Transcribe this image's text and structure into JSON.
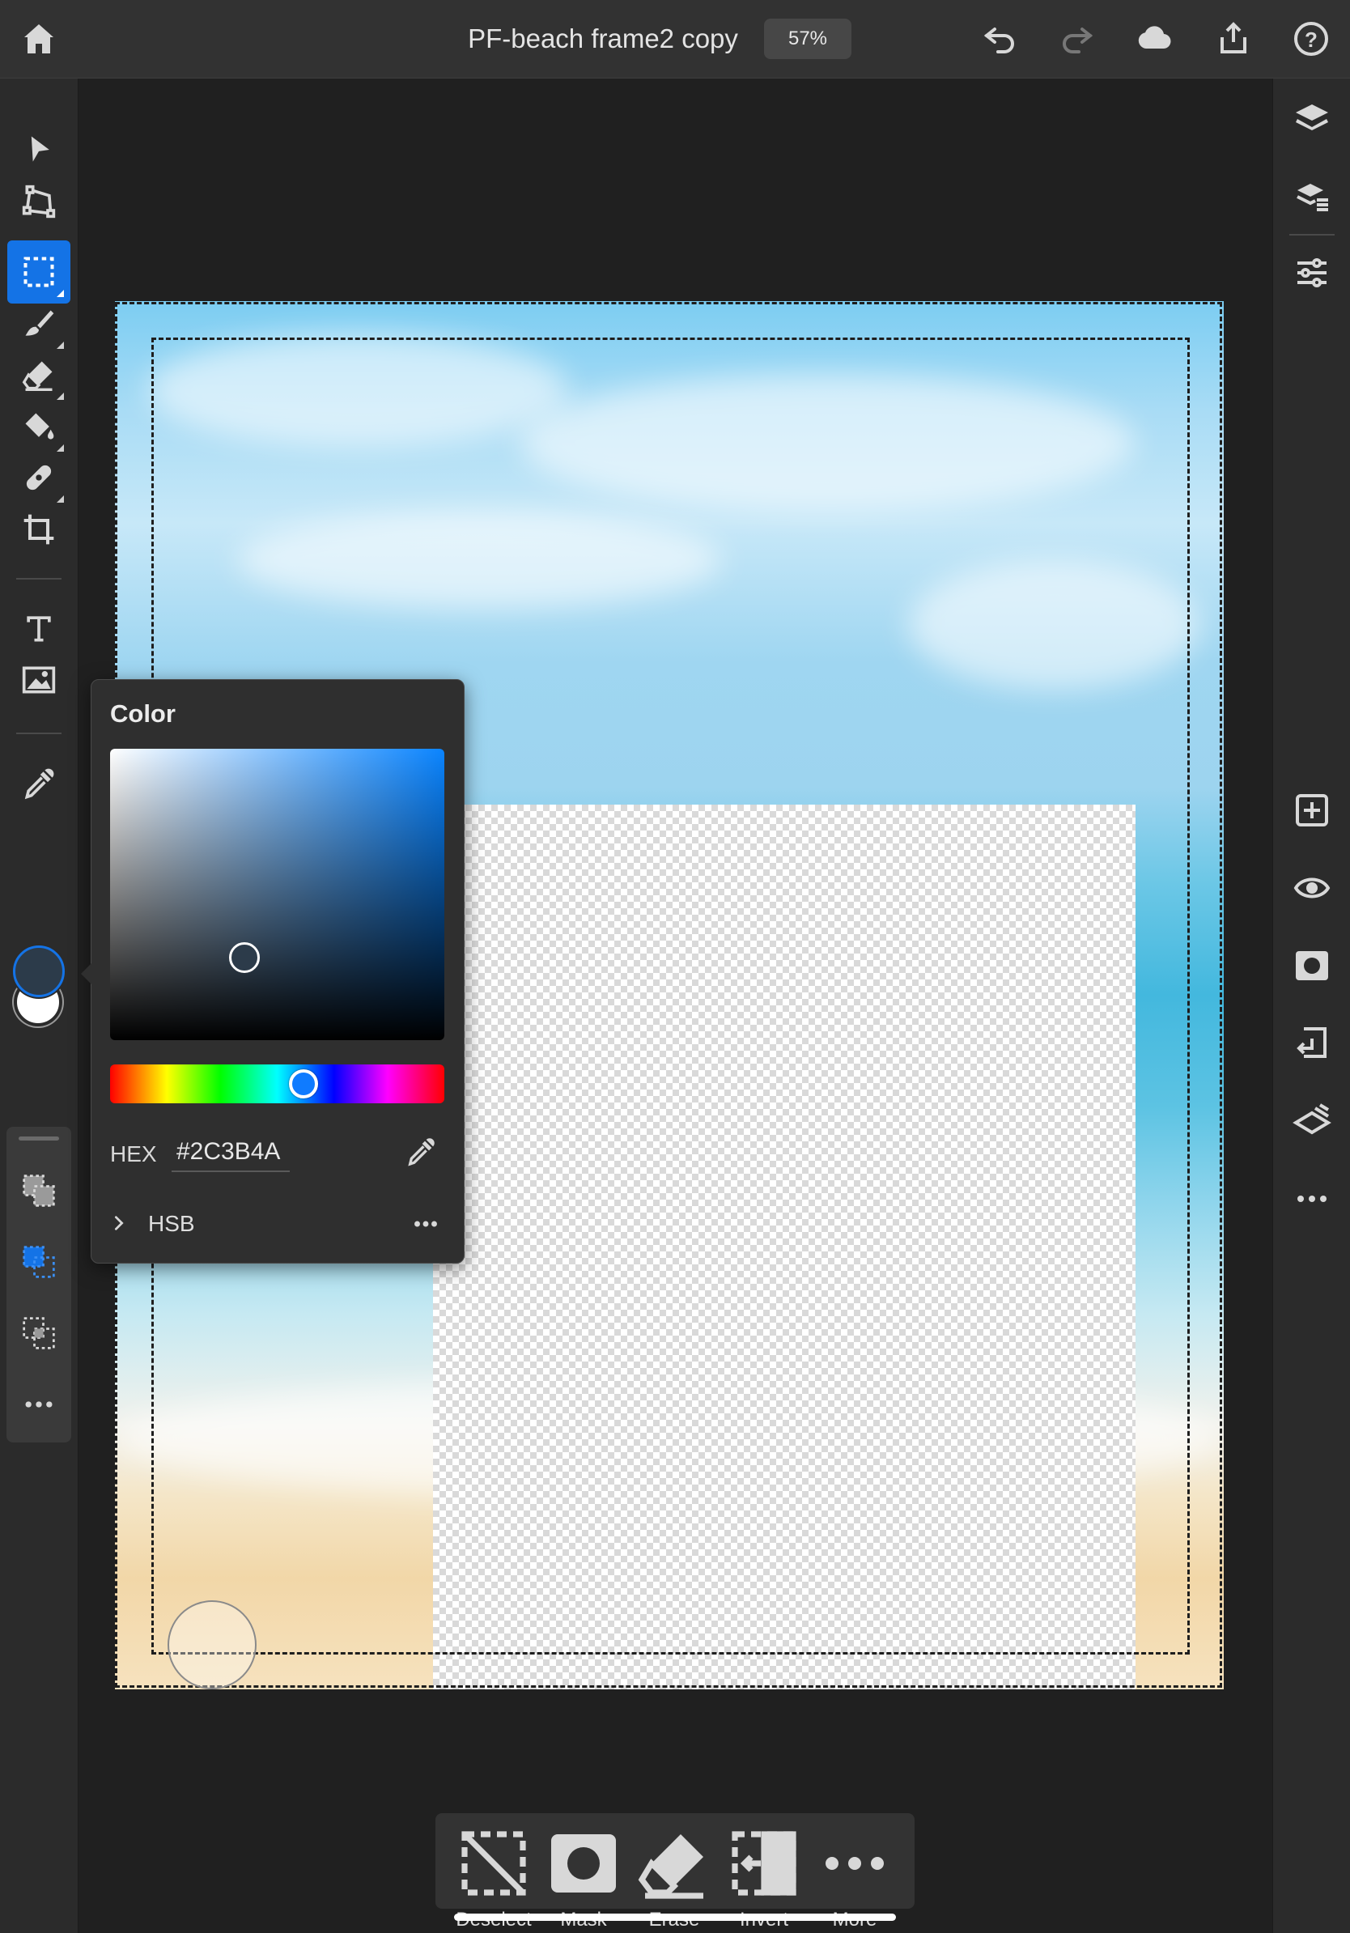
{
  "header": {
    "title": "PF-beach frame2 copy",
    "zoom": "57%",
    "icons": [
      "home-icon",
      "undo-icon",
      "redo-icon",
      "cloud-icon",
      "share-icon",
      "help-icon"
    ]
  },
  "left_toolbar": {
    "tools": [
      "move-tool",
      "transform-tool",
      "selection-tool",
      "brush-tool",
      "eraser-tool",
      "paint-bucket-tool",
      "healing-tool",
      "crop-tool",
      "type-tool",
      "place-image-tool",
      "eyedropper-tool"
    ],
    "active_tool": "selection-tool",
    "selection_modes": [
      "new-selection",
      "add-to-selection",
      "subtract-from-selection",
      "more"
    ]
  },
  "right_panel": {
    "icons": [
      "layers-icon",
      "layer-properties-icon",
      "adjustments-icon",
      "add-layer-icon",
      "visibility-icon",
      "mask-icon",
      "clip-icon",
      "layer-effects-icon",
      "more-icon"
    ]
  },
  "color_popover": {
    "title": "Color",
    "hex_label": "HEX",
    "hex_value": "#2C3B4A",
    "section_label": "HSB"
  },
  "colors": {
    "foreground": "#2C3B4A",
    "background": "#FFFFFF",
    "accent": "#1473E6"
  },
  "bottom_bar": {
    "actions": [
      {
        "label": "Deselect",
        "icon": "deselect-icon"
      },
      {
        "label": "Mask",
        "icon": "mask-icon"
      },
      {
        "label": "Erase",
        "icon": "eraser-icon"
      },
      {
        "label": "Invert",
        "icon": "invert-icon"
      },
      {
        "label": "More",
        "icon": "more-icon"
      }
    ]
  }
}
